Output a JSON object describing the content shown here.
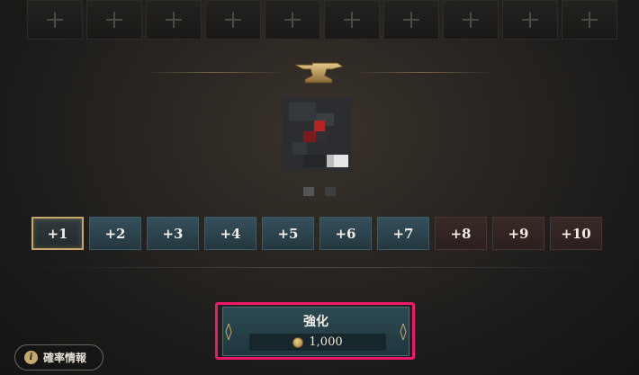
{
  "slots": [
    {
      "icon": "plus-icon"
    },
    {
      "icon": "plus-icon"
    },
    {
      "icon": "plus-icon"
    },
    {
      "icon": "plus-icon"
    },
    {
      "icon": "plus-icon"
    },
    {
      "icon": "plus-icon"
    },
    {
      "icon": "plus-icon"
    },
    {
      "icon": "plus-icon"
    },
    {
      "icon": "plus-icon"
    },
    {
      "icon": "plus-icon"
    }
  ],
  "header": {
    "icon": "anvil-icon"
  },
  "item": {
    "icon": "item-icon"
  },
  "levels": [
    {
      "label": "+1",
      "state": "selected"
    },
    {
      "label": "+2",
      "state": "normal"
    },
    {
      "label": "+3",
      "state": "normal"
    },
    {
      "label": "+4",
      "state": "normal"
    },
    {
      "label": "+5",
      "state": "normal"
    },
    {
      "label": "+6",
      "state": "normal"
    },
    {
      "label": "+7",
      "state": "normal"
    },
    {
      "label": "+8",
      "state": "warm"
    },
    {
      "label": "+9",
      "state": "warm"
    },
    {
      "label": "+10",
      "state": "warm"
    }
  ],
  "enhance": {
    "label": "強化",
    "cost": "1,000",
    "currency_icon": "gold-coin-icon"
  },
  "probability": {
    "label": "確率情報",
    "icon": "info-icon",
    "icon_glyph": "i"
  },
  "colors": {
    "highlight": "#f0186a",
    "accent_gold": "#c7a86b",
    "button_teal": "#2c4a52"
  }
}
